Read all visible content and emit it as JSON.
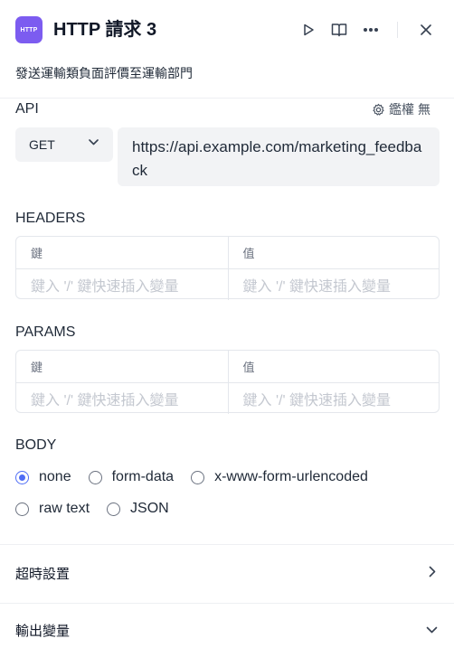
{
  "header": {
    "icon_text": "HTTP",
    "title": "HTTP 請求 3",
    "description": "發送運輸類負面評價至運輸部門"
  },
  "api": {
    "label": "API",
    "auth_label": "鑑權",
    "auth_value": "無",
    "method": "GET",
    "url": "https://api.example.com/marketing_feedback"
  },
  "headers": {
    "label": "HEADERS",
    "key_header": "鍵",
    "value_header": "值",
    "key_placeholder": "鍵入 '/' 鍵快速插入變量",
    "value_placeholder": "鍵入 '/' 鍵快速插入變量"
  },
  "params": {
    "label": "PARAMS",
    "key_header": "鍵",
    "value_header": "值",
    "key_placeholder": "鍵入 '/' 鍵快速插入變量",
    "value_placeholder": "鍵入 '/' 鍵快速插入變量"
  },
  "body": {
    "label": "BODY",
    "options": [
      "none",
      "form-data",
      "x-www-form-urlencoded",
      "raw text",
      "JSON"
    ],
    "selected": "none"
  },
  "timeout": {
    "label": "超時設置"
  },
  "output": {
    "label": "輸出變量"
  },
  "colors": {
    "accent": "#4f6df5",
    "icon_bg": "#7c5cf0"
  },
  "icons": [
    "play-icon",
    "book-icon",
    "more-icon",
    "close-icon",
    "gear-icon",
    "chevron-down-icon",
    "chevron-right-icon"
  ]
}
